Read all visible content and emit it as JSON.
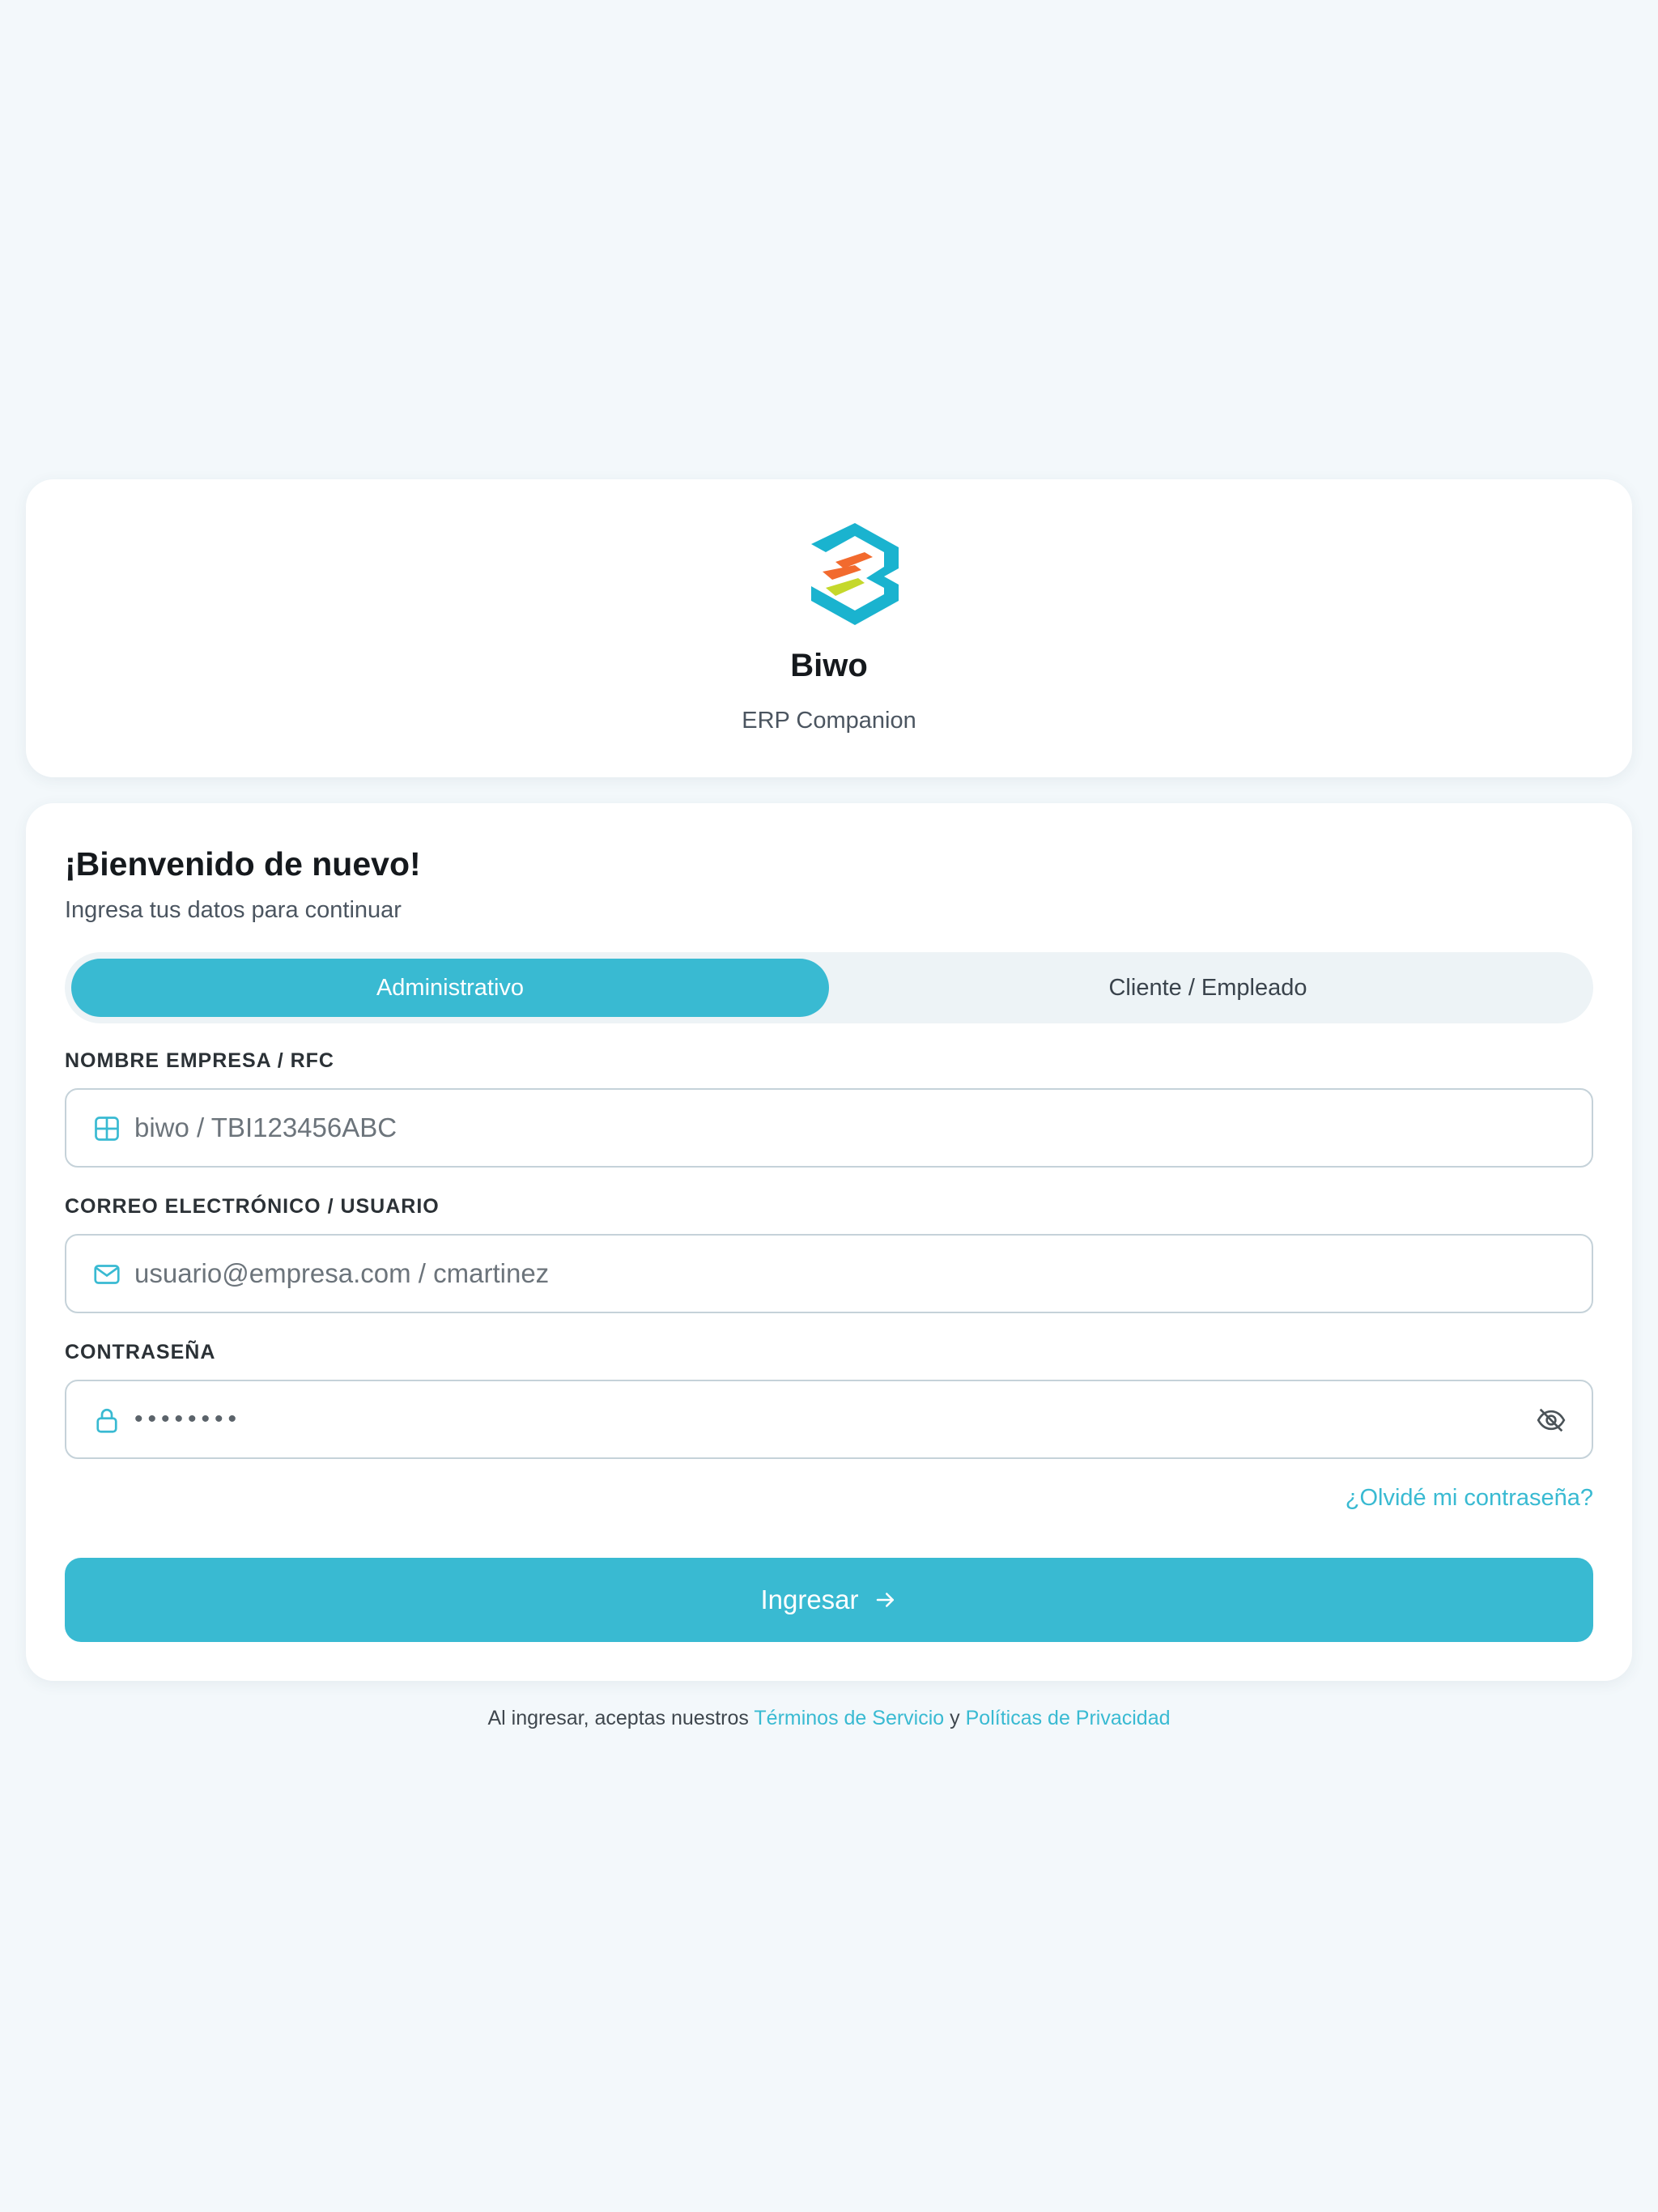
{
  "brand": {
    "name": "Biwo",
    "tagline": "ERP Companion"
  },
  "login": {
    "title": "¡Bienvenido de nuevo!",
    "subtitle": "Ingresa tus datos para continuar",
    "tabs": [
      {
        "label": "Administrativo",
        "active": true
      },
      {
        "label": "Cliente / Empleado",
        "active": false
      }
    ],
    "company": {
      "label": "NOMBRE EMPRESA / RFC",
      "placeholder": "biwo / TBI123456ABC",
      "icon": "grid-icon"
    },
    "email": {
      "label": "CORREO ELECTRÓNICO / USUARIO",
      "placeholder": "usuario@empresa.com / cmartinez",
      "icon": "mail-icon"
    },
    "password": {
      "label": "CONTRASEÑA",
      "masked_value": "••••••••",
      "icon": "lock-icon",
      "toggle_icon": "eye-off-icon"
    },
    "forgot_label": "¿Olvidé mi contraseña?",
    "submit_label": "Ingresar",
    "submit_icon": "arrow-right-icon"
  },
  "footer": {
    "prefix": "Al ingresar, aceptas nuestros",
    "terms": "Términos de Servicio",
    "conjunction": "y",
    "privacy": "Políticas de Privacidad"
  },
  "colors": {
    "background": "#f3f8fb",
    "accent": "#39bad2",
    "logo_teal": "#1ab3cf",
    "logo_orange": "#f26a2e",
    "logo_lime": "#c5d82b"
  }
}
